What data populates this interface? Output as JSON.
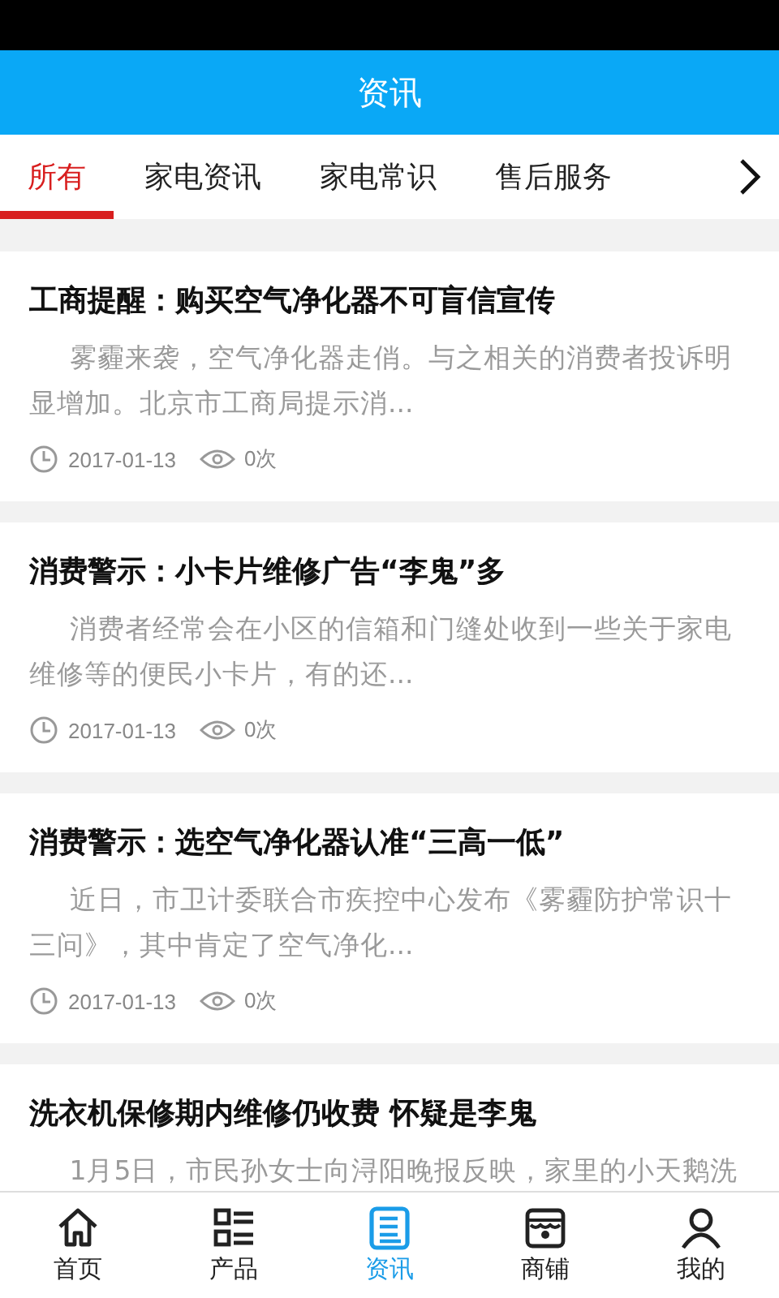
{
  "header": {
    "title": "资讯"
  },
  "tabs": [
    {
      "label": "所有",
      "selected": true
    },
    {
      "label": "家电资讯",
      "selected": false
    },
    {
      "label": "家电常识",
      "selected": false
    },
    {
      "label": "售后服务",
      "selected": false
    }
  ],
  "articles": [
    {
      "title": "工商提醒：购买空气净化器不可盲信宣传",
      "summary": "雾霾来袭，空气净化器走俏。与之相关的消费者投诉明显增加。北京市工商局提示消...",
      "date": "2017-01-13",
      "views": "0次"
    },
    {
      "title": "消费警示：小卡片维修广告“李鬼”多",
      "summary": "消费者经常会在小区的信箱和门缝处收到一些关于家电维修等的便民小卡片，有的还...",
      "date": "2017-01-13",
      "views": "0次"
    },
    {
      "title": "消费警示：选空气净化器认准“三高一低”",
      "summary": "近日，市卫计委联合市疾控中心发布《雾霾防护常识十三问》，其中肯定了空气净化...",
      "date": "2017-01-13",
      "views": "0次"
    },
    {
      "title": "洗衣机保修期内维修仍收费 怀疑是李鬼",
      "summary": "1月5日，市民孙女士向浔阳晚报反映，家里的小天鹅洗"
    }
  ],
  "bottom_nav": [
    {
      "label": "首页",
      "kind": "home",
      "selected": false
    },
    {
      "label": "产品",
      "kind": "products",
      "selected": false
    },
    {
      "label": "资讯",
      "kind": "news",
      "selected": true
    },
    {
      "label": "商铺",
      "kind": "shop",
      "selected": false
    },
    {
      "label": "我的",
      "kind": "profile",
      "selected": false
    }
  ]
}
